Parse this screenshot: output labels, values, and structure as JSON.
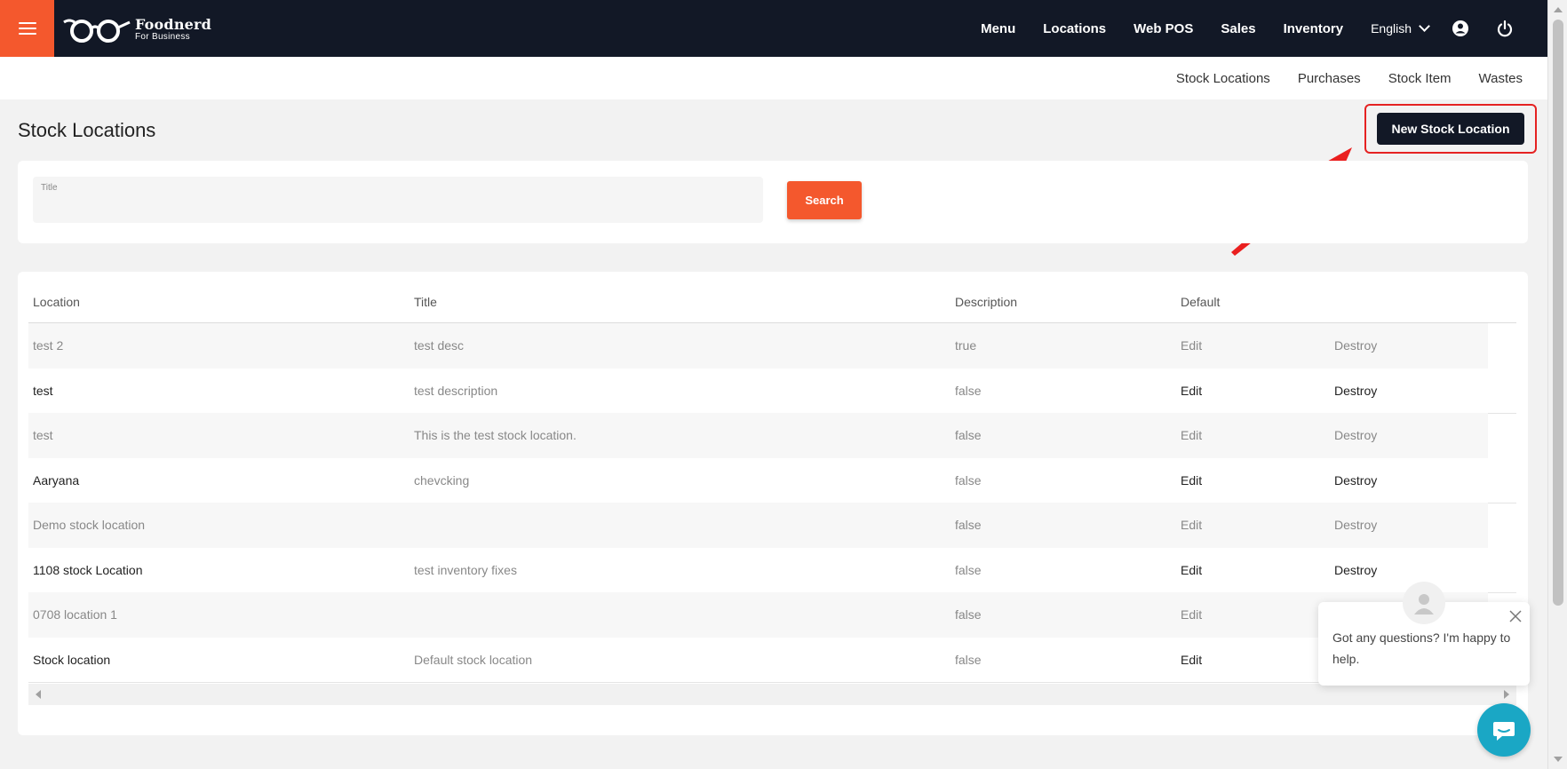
{
  "brand": {
    "name": "Foodnerd",
    "tagline": "For Business"
  },
  "nav": {
    "items": [
      "Menu",
      "Locations",
      "Web POS",
      "Sales",
      "Inventory"
    ],
    "language": "English"
  },
  "subnav": {
    "items": [
      "Stock Locations",
      "Purchases",
      "Stock Item",
      "Wastes"
    ]
  },
  "page": {
    "title": "Stock Locations",
    "new_button": "New Stock Location"
  },
  "search": {
    "field_label": "Title",
    "field_value": "",
    "button": "Search"
  },
  "table": {
    "headers": [
      "Location",
      "Title",
      "Description",
      "Default"
    ],
    "rows": [
      {
        "location": "test 2",
        "title": "test desc",
        "description": "true",
        "edit": "Edit",
        "destroy": "Destroy"
      },
      {
        "location": "test",
        "title": "test description",
        "description": "false",
        "edit": "Edit",
        "destroy": "Destroy"
      },
      {
        "location": "test",
        "title": "This is the test stock location.",
        "description": "false",
        "edit": "Edit",
        "destroy": "Destroy"
      },
      {
        "location": "Aaryana",
        "title": "chevcking",
        "description": "false",
        "edit": "Edit",
        "destroy": "Destroy"
      },
      {
        "location": "Demo stock location",
        "title": "",
        "description": "false",
        "edit": "Edit",
        "destroy": "Destroy"
      },
      {
        "location": "1108 stock Location",
        "title": "test inventory fixes",
        "description": "false",
        "edit": "Edit",
        "destroy": "Destroy"
      },
      {
        "location": "0708 location 1",
        "title": "",
        "description": "false",
        "edit": "Edit",
        "destroy": ""
      },
      {
        "location": "Stock location",
        "title": "Default stock location",
        "description": "false",
        "edit": "Edit",
        "destroy": ""
      }
    ]
  },
  "chat": {
    "message": "Got any questions? I'm happy to help."
  },
  "colors": {
    "navbar": "#121826",
    "accent": "#f4582d",
    "highlight": "#e52222",
    "chat": "#1aa7c5"
  }
}
